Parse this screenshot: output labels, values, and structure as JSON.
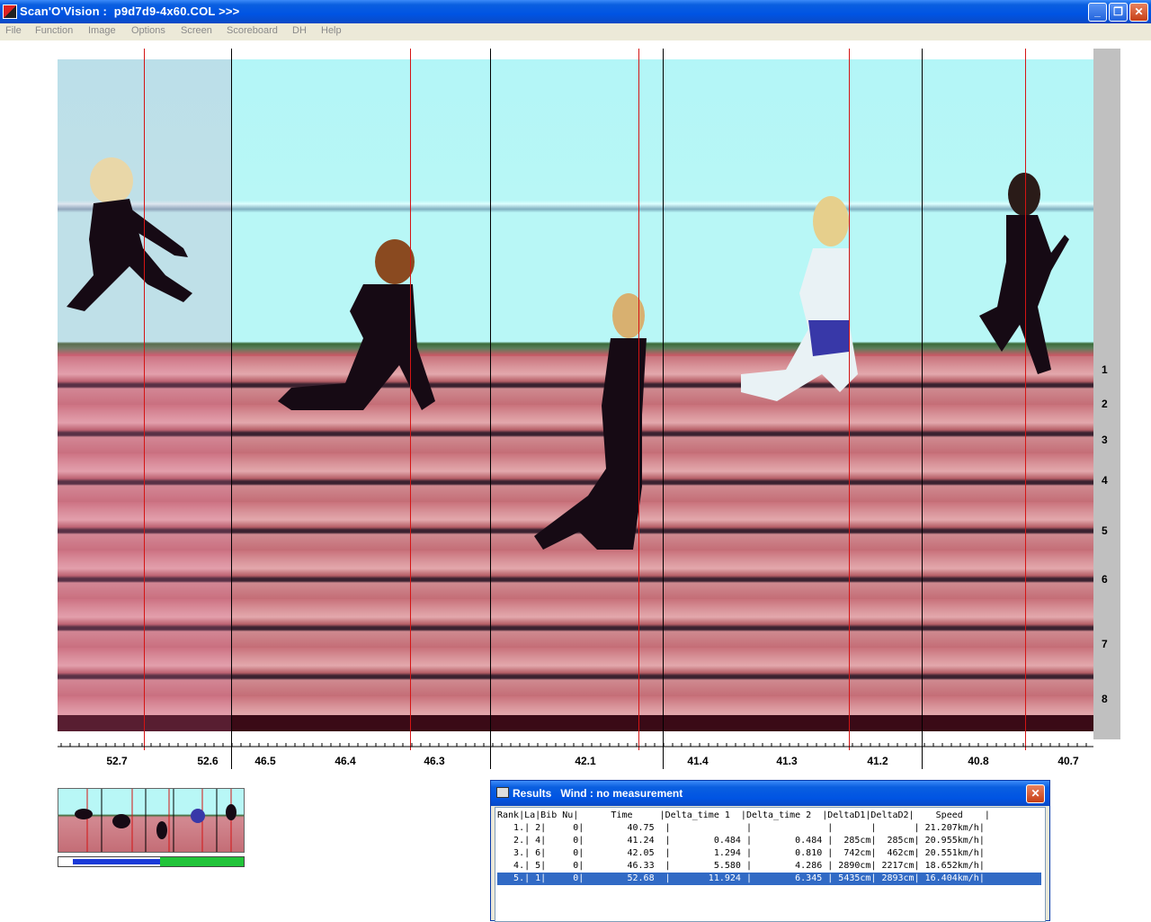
{
  "window": {
    "title": "Scan'O'Vision :  p9d7d9-4x60.COL >>>",
    "buttons": {
      "minimize": "_",
      "maximize": "❐",
      "close": "✕"
    }
  },
  "menu": [
    {
      "label": "File"
    },
    {
      "label": "Function"
    },
    {
      "label": "Image"
    },
    {
      "label": "Options"
    },
    {
      "label": "Screen"
    },
    {
      "label": "Scoreboard"
    },
    {
      "label": "DH"
    },
    {
      "label": "Help"
    }
  ],
  "lanes": [
    "1",
    "2",
    "3",
    "4",
    "5",
    "6",
    "7",
    "8"
  ],
  "ruler_labels": [
    "52.7",
    "52.6",
    "46.5",
    "46.4",
    "46.3",
    "42.1",
    "41.4",
    "41.3",
    "41.2",
    "40.8",
    "40.7"
  ],
  "colors": {
    "accent": "#0054e3",
    "red_line": "#d41414",
    "selection": "#316ac5"
  },
  "results": {
    "title": "Results   Wind : no measurement",
    "header": "Rank|La|Bib Nu|      Time     |Delta_time 1  |Delta_time 2  |DeltaD1|DeltaD2|    Speed    |",
    "rows": [
      "   1.| 2|     0|        40.75  |              |              |       |       | 21.207km/h|",
      "   2.| 4|     0|        41.24  |        0.484 |        0.484 |  285cm|  285cm| 20.955km/h|",
      "   3.| 6|     0|        42.05  |        1.294 |        0.810 |  742cm|  462cm| 20.551km/h|",
      "   4.| 5|     0|        46.33  |        5.580 |        4.286 | 2890cm| 2217cm| 18.652km/h|",
      "   5.| 1|     0|        52.68  |       11.924 |        6.345 | 5435cm| 2893cm| 16.404km/h|"
    ],
    "selected_row": 4
  }
}
